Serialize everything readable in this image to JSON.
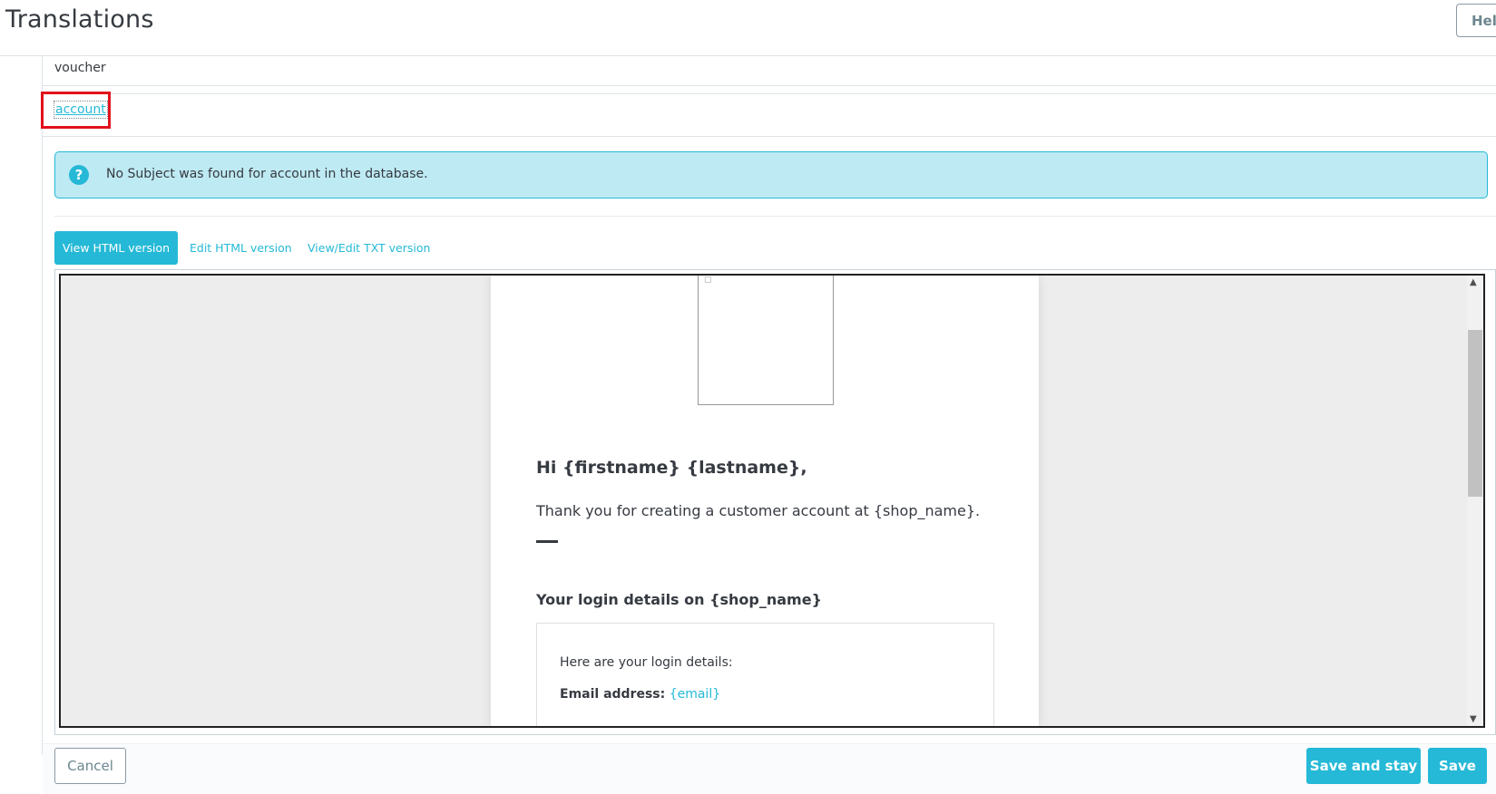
{
  "header": {
    "title": "Translations",
    "help_label": "Help"
  },
  "mail_list": {
    "voucher_label": "voucher",
    "account_label": "account"
  },
  "alert": {
    "icon_glyph": "?",
    "text": "No Subject was found for account in the database."
  },
  "tabs": [
    {
      "label": "View HTML version",
      "active": true
    },
    {
      "label": "Edit HTML version",
      "active": false
    },
    {
      "label": "View/Edit TXT version",
      "active": false
    }
  ],
  "preview": {
    "greeting": "Hi {firstname} {lastname},",
    "thanks": "Thank you for creating a customer account at {shop_name}.",
    "login_heading": "Your login details on {shop_name}",
    "login_intro": "Here are your login details:",
    "email_label": "Email address:",
    "email_value": "{email}"
  },
  "footer": {
    "cancel_label": "Cancel",
    "save_and_stay_label": "Save and stay",
    "save_label": "Save"
  },
  "colors": {
    "accent": "#25b9d7",
    "alert_bg": "#beeaf3",
    "highlight": "#e2121c",
    "text": "#363a41"
  }
}
